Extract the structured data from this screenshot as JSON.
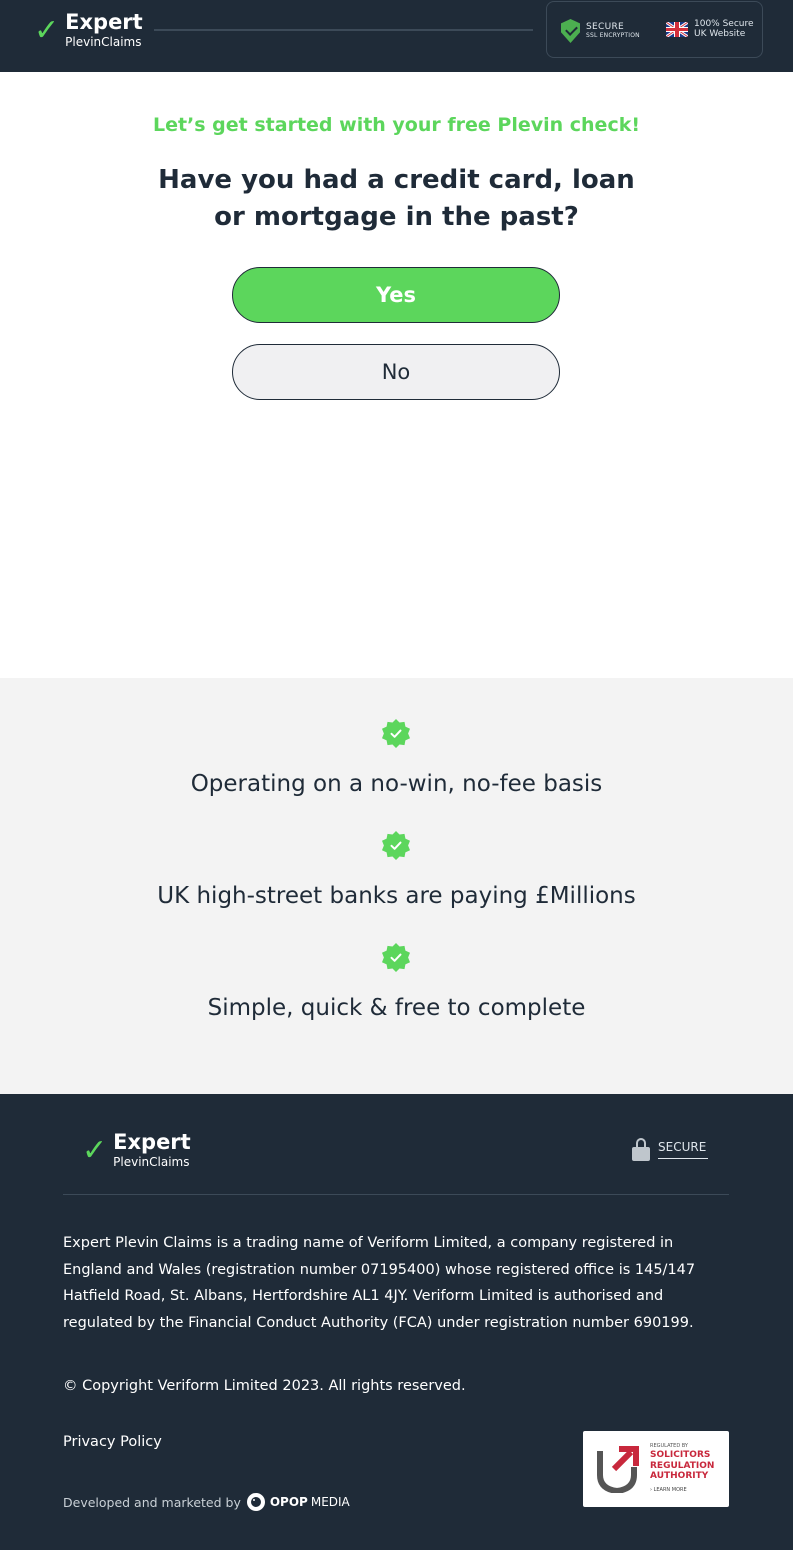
{
  "brand": {
    "logo_line1": "Expert",
    "logo_line2": "PlevinClaims",
    "check_glyph": "✓",
    "accent_color": "#5cd65c",
    "dark_color": "#1f2b38"
  },
  "header": {
    "secure_line1": "SECURE",
    "secure_line2": "SSL ENCRYPTION",
    "uk_line1": "100% Secure",
    "uk_line2": "UK Website"
  },
  "main": {
    "tagline": "Let’s get started with your free Plevin check!",
    "question": "Have you had a credit card, loan or mortgage in the past?",
    "yes_label": "Yes",
    "no_label": "No"
  },
  "features": [
    {
      "icon": "verified-badge-icon",
      "text": "Operating on a no-win, no-fee basis"
    },
    {
      "icon": "verified-badge-icon",
      "text": "UK high-street banks are paying £Millions"
    },
    {
      "icon": "verified-badge-icon",
      "text": "Simple, quick & free to complete"
    }
  ],
  "footer": {
    "secure_label": "SECURE",
    "legal": "Expert Plevin Claims is a trading name of Veriform Limited, a company registered in England and Wales (registration number 07195400) whose registered office is 145/147 Hatfield Road, St. Albans, Hertfordshire AL1 4JY. Veriform Limited is authorised and regulated by the Financial Conduct Authority (FCA) under registration number 690199.",
    "copyright": "© Copyright Veriform Limited 2023. All rights reserved.",
    "privacy_label": "Privacy Policy",
    "developed_label": "Developed and marketed by",
    "opop_name": "OPOP",
    "opop_media": "MEDIA",
    "sra_small": "REGULATED BY",
    "sra_line1": "SOLICITORS",
    "sra_line2": "REGULATION",
    "sra_line3": "AUTHORITY",
    "sra_more": "› LEARN MORE"
  }
}
